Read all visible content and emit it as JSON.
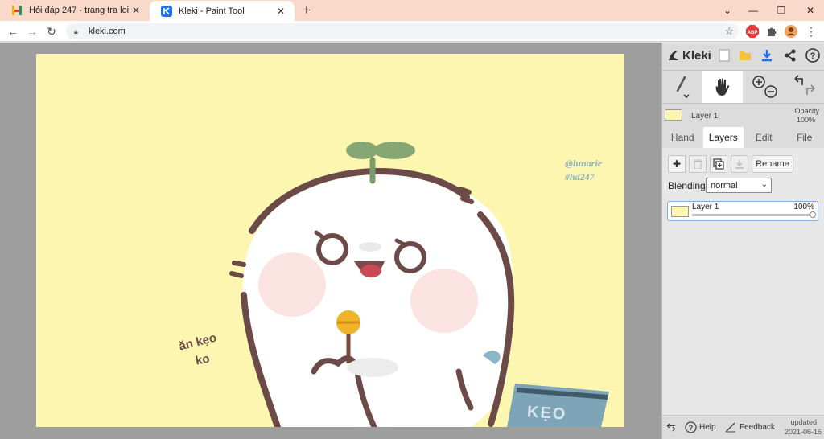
{
  "browser": {
    "tabs": [
      {
        "title": "Hỏi đáp 247 - trang tra loi",
        "favicon_color": "#f4b400",
        "active": false
      },
      {
        "title": "Kleki - Paint Tool",
        "favicon_color": "#1a73e8",
        "active": true
      }
    ],
    "new_tab_label": "+",
    "url": "kleki.com"
  },
  "panel": {
    "app_name": "Kleki",
    "layer_name": "Layer 1",
    "opacity_label": "Opacity",
    "opacity_value": "100%",
    "tabs": [
      "Hand",
      "Layers",
      "Edit",
      "File"
    ],
    "selected_tab": "Layers",
    "rename_label": "Rename",
    "blending_label": "Blending",
    "blending_value": "normal",
    "layers": [
      {
        "name": "Layer 1",
        "opacity": "100%"
      }
    ],
    "footer": {
      "help_label": "Help",
      "feedback_label": "Feedback",
      "updated_label": "updated",
      "updated_date": "2021-06-16"
    }
  },
  "artwork": {
    "watermark_line1": "@lunarie",
    "watermark_line2": "#hd247",
    "handwriting_line1": "ăn kẹo",
    "handwriting_line2": "ko",
    "bag_label": "KẸO",
    "canvas_color": "#fdf6b1",
    "outline_color": "#6b4a48"
  }
}
